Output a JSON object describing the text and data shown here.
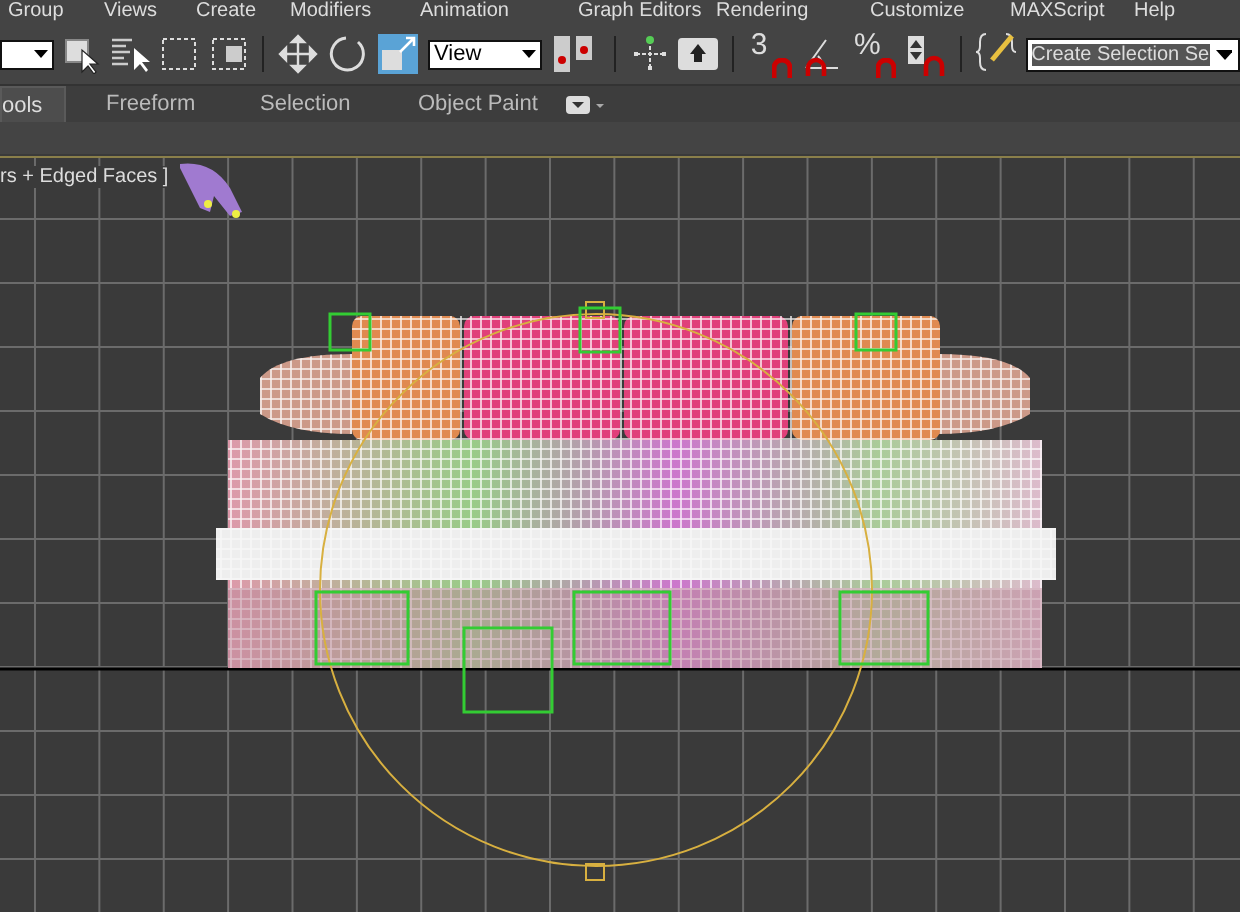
{
  "menu_bar": {
    "items": [
      "Group",
      "Views",
      "Create",
      "Modifiers",
      "Animation",
      "Graph Editors",
      "Rendering",
      "Customize",
      "MAXScript",
      "Help"
    ]
  },
  "toolbar": {
    "reference_dropdown": {
      "expanded": false
    },
    "view_dropdown": {
      "value": "View"
    },
    "snap_3d_label": "3",
    "percent_snap_label": "%",
    "named_selection_field": {
      "value": "Create Selection Se"
    }
  },
  "ribbon": {
    "tabs": [
      {
        "label": "ools",
        "selected": true
      },
      {
        "label": "Freeform",
        "selected": false
      },
      {
        "label": "Selection",
        "selected": false
      },
      {
        "label": "Object Paint",
        "selected": false
      }
    ]
  },
  "viewport": {
    "label": "rs + Edged Faces ]"
  }
}
